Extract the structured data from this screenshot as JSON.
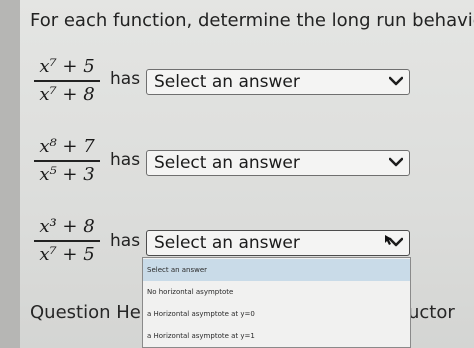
{
  "heading": "For each function, determine the long run behavior",
  "questions": [
    {
      "numerator": "x⁷ + 5",
      "denominator": "x⁷ + 8",
      "has_label": "has",
      "select_value": "Select an answer"
    },
    {
      "numerator": "x⁸ + 7",
      "denominator": "x⁵ + 3",
      "has_label": "has",
      "select_value": "Select an answer"
    },
    {
      "numerator": "x³ + 8",
      "denominator": "x⁷ + 5",
      "has_label": "has",
      "select_value": "Select an answer"
    }
  ],
  "dropdown": {
    "options": [
      "Select an answer",
      "No horizontal asymptote",
      "a Horizontal asymptote at y=0",
      "a Horizontal asymptote at y=1"
    ],
    "highlighted_index": 0
  },
  "footer": {
    "question_help": "Question Help",
    "right_text": "uctor"
  },
  "colors": {
    "highlight": "#c9dbe8",
    "page_bg": "#e0e1df"
  }
}
